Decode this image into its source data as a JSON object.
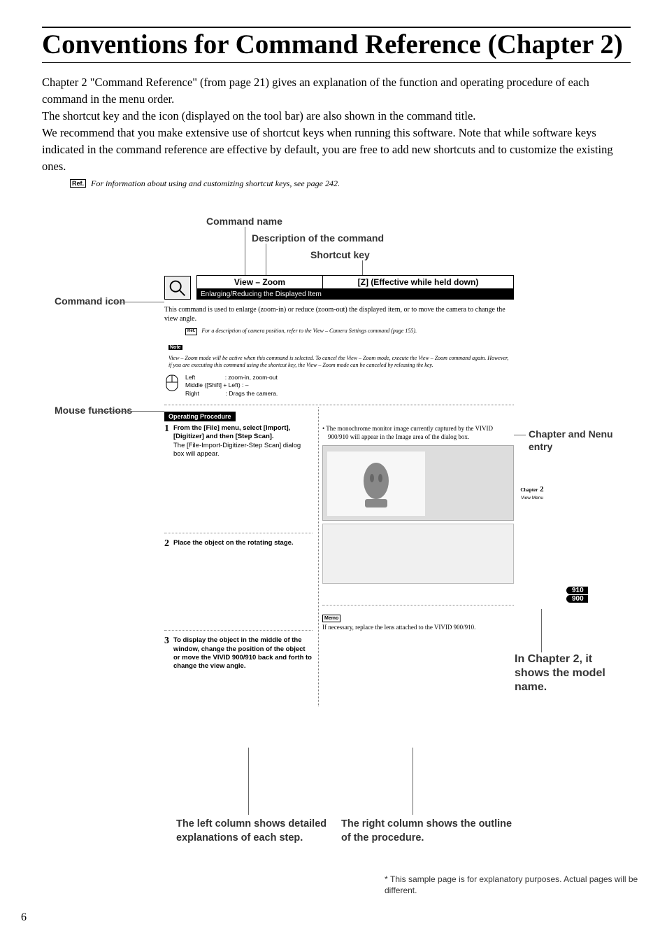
{
  "title": "Conventions for Command Reference (Chapter 2)",
  "intro_p1": "Chapter 2 \"Command Reference\" (from page 21) gives an explanation of the function and operating procedure of each command in the menu order.",
  "intro_p2": "The shortcut key and the icon (displayed on the tool bar) are also shown in the command title.",
  "intro_p3": "We recommend that you make extensive use of shortcut keys when running this software. Note that while software keys indicated in the command reference are effective by default, you are free to add new shortcuts and to customize the existing ones.",
  "ref_label": "Ref.",
  "ref_text": "For information about using and customizing shortcut keys, see page 242.",
  "callouts": {
    "command_name": "Command name",
    "description": "Description of the command",
    "shortcut_key": "Shortcut key",
    "command_icon": "Command icon",
    "mouse_functions": "Mouse functions",
    "chapter_menu": "Chapter and Nenu entry",
    "model_right": "In Chapter 2, it shows the model name.",
    "left_column": "The left column shows detailed explanations of each step.",
    "right_column": "The right column shows the outline of the procedure."
  },
  "sample": {
    "cmd_title": "View – Zoom",
    "shortcut": "[Z] (Effective while held down)",
    "subtitle": "Enlarging/Reducing the Displayed Item",
    "desc": "This command is used to enlarge (zoom-in) or reduce (zoom-out) the displayed item, or to move the camera to change the view angle.",
    "ref_small_label": "Ref.",
    "ref_small": "For a description of camera position, refer to the View – Camera Settings command (page 155).",
    "note_label": "Note",
    "note_text": "View – Zoom mode will be active when this command is selected. To cancel the View – Zoom mode, execute the View – Zoom command again. However, if you are executing this command using the shortcut key, the View – Zoom mode can be canceled by releasing the key.",
    "mouse": {
      "left_label": "Left",
      "left_desc": ": zoom-in, zoom-out",
      "mid_label": "Middle ([Shift] + Left)",
      "mid_desc": ": –",
      "right_label": "Right",
      "right_desc": ": Drags the camera."
    },
    "op_header": "Operating Procedure",
    "steps": {
      "s1": {
        "num": "1",
        "bold": "From the [File] menu, select [Import], [Digitizer] and then [Step Scan].",
        "plain": "The [File-Import-Digitizer-Step Scan] dialog box will appear."
      },
      "s2": {
        "num": "2",
        "bold": "Place the object on the rotating stage."
      },
      "s3": {
        "num": "3",
        "bold": "To display the object in the middle of the window, change the position of the object or move the VIVID 900/910 back and forth to change the view angle."
      }
    },
    "right_bullet": "The monochrome monitor image currently captured by the VIVID 900/910 will appear in the Image area of the dialog box.",
    "memo_label": "Memo",
    "memo_text": "If necessary, replace the lens attached to the VIVID 900/910.",
    "chapter_tab_label": "Chapter",
    "chapter_num": "2",
    "tab_menu": "View Menu",
    "model_910": "910",
    "model_900": "900"
  },
  "footnote_star": "*",
  "footnote": "This sample page is for explanatory purposes. Actual pages will be different.",
  "page_number": "6"
}
